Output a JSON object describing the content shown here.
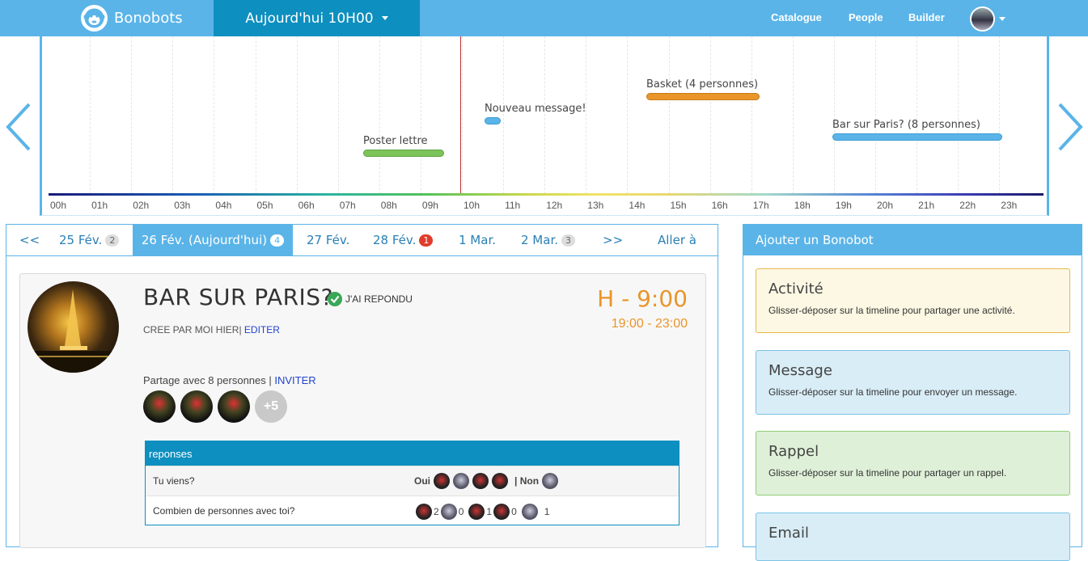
{
  "nav": {
    "brand": "Bonobots",
    "current_date": "Aujourd'hui 10H00",
    "links": [
      "Catalogue",
      "People",
      "Builder"
    ]
  },
  "timeline": {
    "hours": [
      "00h",
      "01h",
      "02h",
      "03h",
      "04h",
      "05h",
      "06h",
      "07h",
      "08h",
      "09h",
      "10h",
      "11h",
      "12h",
      "13h",
      "14h",
      "15h",
      "16h",
      "17h",
      "18h",
      "19h",
      "20h",
      "21h",
      "22h",
      "23h"
    ],
    "events": [
      {
        "label": "Poster lettre",
        "color": "#7cc35a"
      },
      {
        "label": "Nouveau message!",
        "color": "#5ab4e8"
      },
      {
        "label": "Basket (4 personnes)",
        "color": "#e9952a"
      },
      {
        "label": "Bar sur Paris? (8 personnes)",
        "color": "#5ab4e8"
      }
    ]
  },
  "tabs": [
    {
      "label": "<<"
    },
    {
      "label": "25 Fév.",
      "badge": "2"
    },
    {
      "label": "26 Fév. (Aujourd'hui)",
      "badge": "4"
    },
    {
      "label": "27 Fév."
    },
    {
      "label": "28 Fév.",
      "badge": "1"
    },
    {
      "label": "1 Mar."
    },
    {
      "label": "2 Mar.",
      "badge": "3"
    },
    {
      "label": ">>"
    },
    {
      "label": "Aller à"
    }
  ],
  "event": {
    "title": "BAR SUR PARIS?",
    "answered": "J'AI REPONDU",
    "created": "CREE PAR MOI HIER|",
    "edit": "EDITER",
    "time": "H - 9:00",
    "range": "19:00 - 23:00",
    "share": "Partage avec 8 personnes |",
    "invite": "INVITER",
    "more": "+5"
  },
  "responses": {
    "header": "reponses",
    "rows": [
      {
        "question": "Tu viens?",
        "yes": "Oui",
        "no": "| Non"
      },
      {
        "question": "Combien de personnes avec toi?",
        "counts": [
          "2",
          "0",
          "1",
          "0",
          "1"
        ]
      }
    ]
  },
  "add": {
    "header": "Ajouter un Bonobot",
    "items": [
      {
        "title": "Activité",
        "desc": "Glisser-déposer sur la timeline pour partager une activité."
      },
      {
        "title": "Message",
        "desc": "Glisser-déposer sur la timeline pour envoyer un message."
      },
      {
        "title": "Rappel",
        "desc": "Glisser-déposer sur la timeline pour partager un rappel."
      },
      {
        "title": "Email",
        "desc": ""
      }
    ]
  },
  "colors": {
    "primary": "#5ab4e8",
    "dark_primary": "#0d8fbf",
    "orange": "#e9952a",
    "green": "#7cc35a"
  }
}
